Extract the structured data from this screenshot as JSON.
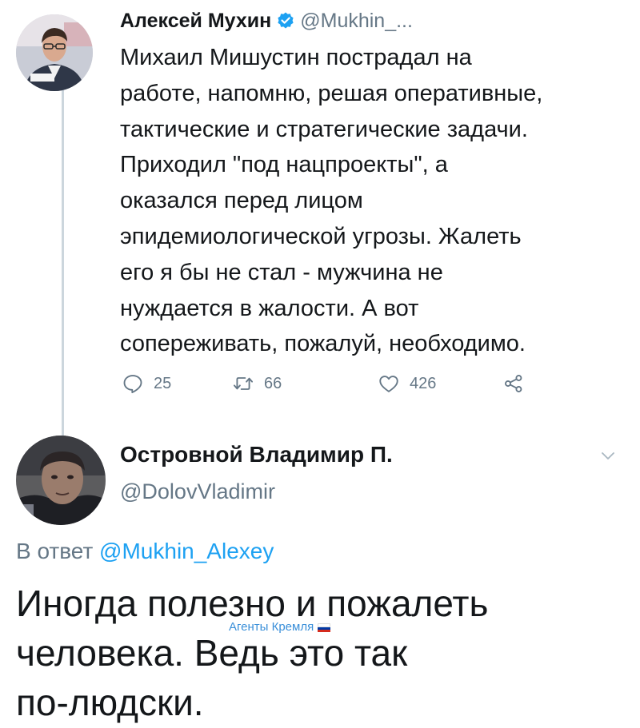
{
  "tweet": {
    "author_name": "Алексей Мухин",
    "author_handle": "@Mukhin_...",
    "text_lines": [
      "Михаил Мишустин пострадал на",
      "работе, напомню, решая оперативные,",
      "тактические и стратегические задачи.",
      "Приходил \"под нацпроекты\", а",
      "оказался перед лицом",
      "эпидемиологической угрозы. Жалеть",
      "его я бы не стал - мужчина не",
      "нуждается в жалости. А вот",
      "сопереживать, пожалуй, необходимо."
    ],
    "replies_count": "25",
    "retweets_count": "66",
    "likes_count": "426"
  },
  "reply": {
    "author_name": "Островной Владимир П.",
    "author_handle": "@DolovVladimir",
    "in_reply_prefix": "В ответ",
    "in_reply_handle": "@Mukhin_Alexey",
    "text_lines": [
      "Иногда полезно и пожалеть",
      "человека. Ведь это так",
      "по-людски."
    ]
  },
  "watermark": {
    "text": "Агенты Кремля",
    "flag_colors": [
      "#ffffff",
      "#0039a6",
      "#d52b1e"
    ]
  },
  "icons": {
    "verified": "verified-badge-icon",
    "reply": "reply-icon",
    "retweet": "retweet-icon",
    "like": "heart-icon",
    "share": "share-icon",
    "more": "chevron-down-icon"
  },
  "colors": {
    "text": "#14171a",
    "secondary": "#657786",
    "link": "#1da1f2",
    "thread_line": "#ccd6dd"
  }
}
